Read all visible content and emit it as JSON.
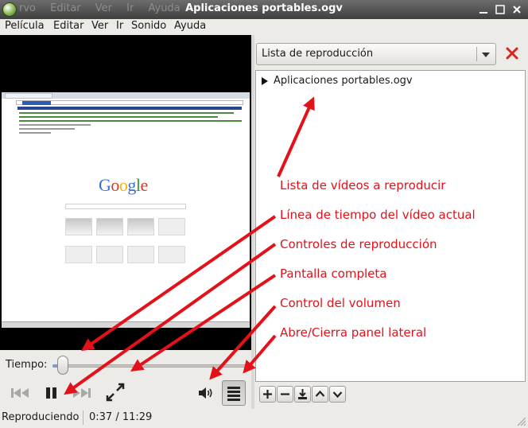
{
  "window": {
    "title": "Aplicaciones portables.ogv",
    "ghost_menu": [
      "rvo",
      "Editar",
      "Ver",
      "Ir",
      "Ayuda"
    ],
    "buttons": [
      "minimize",
      "maximize",
      "close"
    ]
  },
  "menubar": [
    "Película",
    "Editar",
    "Ver",
    "Ir",
    "Sonido",
    "Ayuda"
  ],
  "video": {
    "google_logo": "Google"
  },
  "time": {
    "label": "Tiempo:",
    "progress": 0.054
  },
  "controls": {
    "icons": [
      "previous-icon",
      "pause-icon",
      "next-icon",
      "fullscreen-icon",
      "volume-icon",
      "sidebar-toggle-icon"
    ]
  },
  "status": {
    "state": "Reproduciendo",
    "time": "0:37 / 11:29"
  },
  "sidebar": {
    "combo_label": "Lista de reproducción",
    "playlist": [
      {
        "name": "Aplicaciones portables.ogv",
        "playing": true
      }
    ],
    "buttons": [
      "+",
      "−",
      "save",
      "up",
      "down"
    ]
  },
  "annotations": [
    "Lista de vídeos a reproducir",
    "Línea de tiempo del vídeo actual",
    "Controles de reproducción",
    "Pantalla completa",
    "Control del volumen",
    "Abre/Cierra panel lateral"
  ],
  "colors": {
    "annotation": "#e3121a",
    "titlebar": "#4d4d4d",
    "close_sidebar": "#d8261c"
  }
}
